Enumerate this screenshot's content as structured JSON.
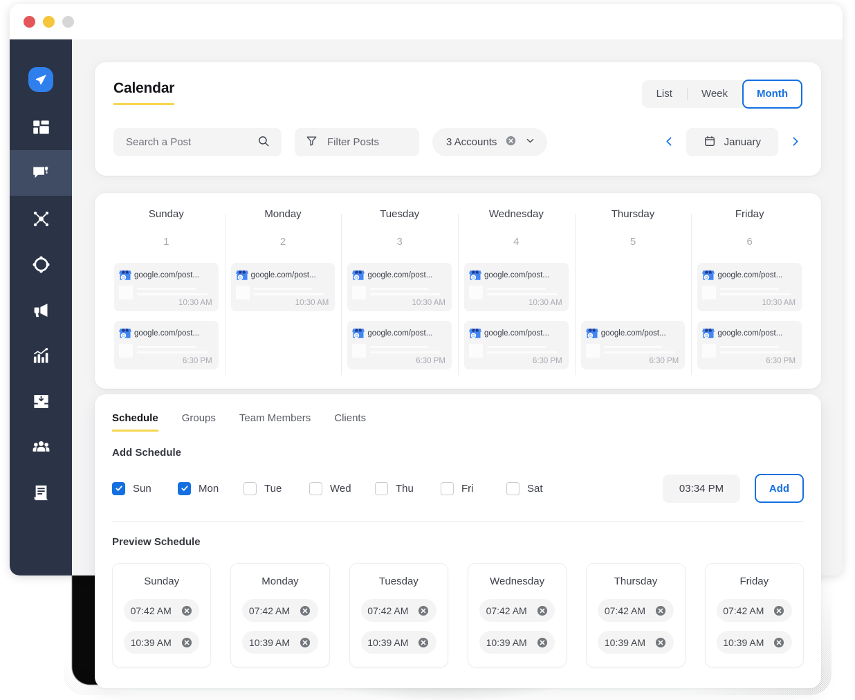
{
  "window": {
    "traffic_lights": [
      "close",
      "minimize",
      "maximize"
    ]
  },
  "sidebar": {
    "items": [
      {
        "icon": "send-paper-plane-icon",
        "name": "brand-logo",
        "active": false
      },
      {
        "icon": "dashboard-grid-icon",
        "name": "sidebar-item-dashboard",
        "active": false
      },
      {
        "icon": "post-compose-icon",
        "name": "sidebar-item-posts",
        "active": true
      },
      {
        "icon": "network-share-icon",
        "name": "sidebar-item-network",
        "active": false
      },
      {
        "icon": "target-compass-icon",
        "name": "sidebar-item-targets",
        "active": false
      },
      {
        "icon": "megaphone-icon",
        "name": "sidebar-item-campaigns",
        "active": false
      },
      {
        "icon": "analytics-chart-icon",
        "name": "sidebar-item-analytics",
        "active": false
      },
      {
        "icon": "inbox-download-icon",
        "name": "sidebar-item-inbox",
        "active": false
      },
      {
        "icon": "users-group-icon",
        "name": "sidebar-item-team",
        "active": false
      },
      {
        "icon": "document-report-icon",
        "name": "sidebar-item-reports",
        "active": false
      }
    ]
  },
  "header": {
    "title": "Calendar",
    "views": [
      {
        "label": "List",
        "active": false
      },
      {
        "label": "Week",
        "active": false
      },
      {
        "label": "Month",
        "active": true
      }
    ],
    "search": {
      "placeholder": "Search a Post",
      "value": "",
      "icon": "search-icon"
    },
    "filter": {
      "label": "Filter Posts",
      "icon": "filter-funnel-icon"
    },
    "accounts": {
      "label": "3 Accounts",
      "clear_icon": "clear-circle-icon",
      "chevron_icon": "chevron-down-icon"
    },
    "month_nav": {
      "prev_icon": "chevron-left-icon",
      "next_icon": "chevron-right-icon",
      "calendar_icon": "calendar-icon",
      "month": "January"
    }
  },
  "calendar": {
    "columns": [
      {
        "day": "Sunday",
        "date": "1",
        "posts": [
          {
            "url": "google.com/post...",
            "time": "10:30 AM",
            "icon": "google-business-icon"
          },
          {
            "url": "google.com/post...",
            "time": "6:30 PM",
            "icon": "google-business-icon"
          }
        ]
      },
      {
        "day": "Monday",
        "date": "2",
        "posts": [
          {
            "url": "google.com/post...",
            "time": "10:30 AM",
            "icon": "google-business-icon"
          }
        ]
      },
      {
        "day": "Tuesday",
        "date": "3",
        "posts": [
          {
            "url": "google.com/post...",
            "time": "10:30 AM",
            "icon": "google-business-icon"
          },
          {
            "url": "google.com/post...",
            "time": "6:30 PM",
            "icon": "google-business-icon"
          }
        ]
      },
      {
        "day": "Wednesday",
        "date": "4",
        "posts": [
          {
            "url": "google.com/post...",
            "time": "10:30 AM",
            "icon": "google-business-icon"
          },
          {
            "url": "google.com/post...",
            "time": "6:30 PM",
            "icon": "google-business-icon"
          }
        ]
      },
      {
        "day": "Thursday",
        "date": "5",
        "posts": [
          {
            "url": "",
            "time": "",
            "icon": ""
          },
          {
            "url": "google.com/post...",
            "time": "6:30 PM",
            "icon": "google-business-icon"
          }
        ]
      },
      {
        "day": "Friday",
        "date": "6",
        "posts": [
          {
            "url": "google.com/post...",
            "time": "10:30 AM",
            "icon": "google-business-icon"
          },
          {
            "url": "google.com/post...",
            "time": "6:30 PM",
            "icon": "google-business-icon"
          }
        ]
      }
    ]
  },
  "schedule": {
    "tabs": [
      {
        "label": "Schedule",
        "active": true
      },
      {
        "label": "Groups",
        "active": false
      },
      {
        "label": "Team Members",
        "active": false
      },
      {
        "label": "Clients",
        "active": false
      }
    ],
    "add_schedule_label": "Add Schedule",
    "days": [
      {
        "label": "Sun",
        "checked": true
      },
      {
        "label": "Mon",
        "checked": true
      },
      {
        "label": "Tue",
        "checked": false
      },
      {
        "label": "Wed",
        "checked": false
      },
      {
        "label": "Thu",
        "checked": false
      },
      {
        "label": "Fri",
        "checked": false
      },
      {
        "label": "Sat",
        "checked": false
      }
    ],
    "time_value": "03:34 PM",
    "add_button": "Add",
    "preview_label": "Preview Schedule",
    "preview": [
      {
        "day": "Sunday",
        "times": [
          "07:42 AM",
          "10:39 AM"
        ]
      },
      {
        "day": "Monday",
        "times": [
          "07:42 AM",
          "10:39 AM"
        ]
      },
      {
        "day": "Tuesday",
        "times": [
          "07:42 AM",
          "10:39 AM"
        ]
      },
      {
        "day": "Wednesday",
        "times": [
          "07:42 AM",
          "10:39 AM"
        ]
      },
      {
        "day": "Thursday",
        "times": [
          "07:42 AM",
          "10:39 AM"
        ]
      },
      {
        "day": "Friday",
        "times": [
          "07:42 AM",
          "10:39 AM"
        ]
      }
    ],
    "remove_icon": "remove-circle-icon"
  },
  "colors": {
    "sidebar_bg": "#2b3447",
    "sidebar_active": "#404c63",
    "accent_blue": "#1470e0",
    "accent_yellow": "#f5d64e",
    "page_bg": "#f4f4f5",
    "card_bg": "#ffffff",
    "text_primary": "#16161a",
    "text_muted": "#a9abb1",
    "traffic_red": "#e4565a",
    "traffic_yellow": "#f5c63c",
    "traffic_grey": "#d6d6d6"
  }
}
